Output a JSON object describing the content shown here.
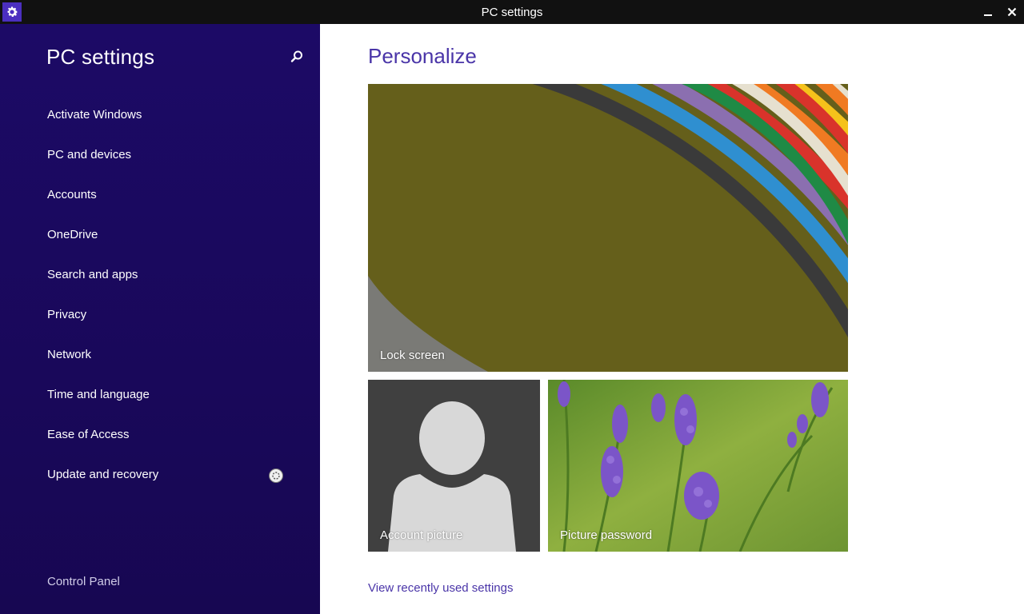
{
  "window": {
    "title": "PC settings",
    "icon": "gear-icon",
    "minimize_icon": "minimize-icon",
    "close_icon": "close-icon"
  },
  "sidebar": {
    "title": "PC settings",
    "search_icon": "search-icon",
    "items": [
      {
        "label": "Activate Windows"
      },
      {
        "label": "PC and devices"
      },
      {
        "label": "Accounts"
      },
      {
        "label": "OneDrive"
      },
      {
        "label": "Search and apps"
      },
      {
        "label": "Privacy"
      },
      {
        "label": "Network"
      },
      {
        "label": "Time and language"
      },
      {
        "label": "Ease of Access"
      },
      {
        "label": "Update and recovery"
      }
    ],
    "control_panel_label": "Control Panel"
  },
  "main": {
    "title": "Personalize",
    "tiles": {
      "lock_screen": {
        "label": "Lock screen"
      },
      "account_picture": {
        "label": "Account picture"
      },
      "picture_password": {
        "label": "Picture password"
      }
    },
    "recent_link": "View recently used settings"
  },
  "colors": {
    "sidebar_bg": "#1c0a66",
    "accent": "#4a35a8",
    "titlebar_bg": "#111111"
  }
}
